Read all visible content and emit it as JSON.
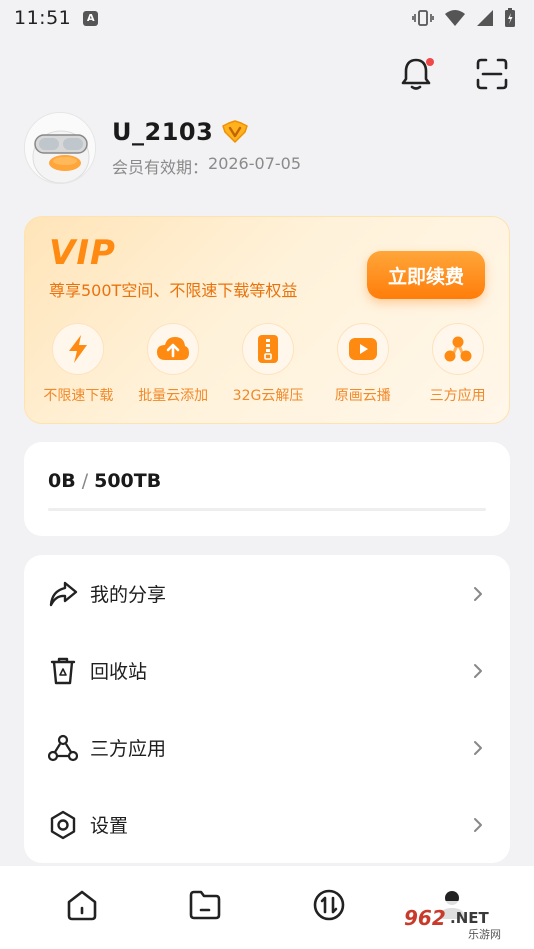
{
  "status_bar": {
    "time": "11:51",
    "badge_letter": "A",
    "icons": [
      "a-icon",
      "vibrate-icon",
      "wifi-icon",
      "signal-icon",
      "battery-icon"
    ]
  },
  "top_actions": {
    "icons": [
      "bell-icon",
      "scan-icon"
    ],
    "has_notification": true
  },
  "profile": {
    "username": "U_2103",
    "member_label": "会员有效期：",
    "member_expiry": "2026-07-05"
  },
  "vip": {
    "title": "VIP",
    "description": "尊享500T空间、不限速下载等权益",
    "renew_label": "立即续费",
    "features": [
      {
        "label": "不限速下载",
        "icon": "lightning-icon"
      },
      {
        "label": "批量云添加",
        "icon": "cloud-upload-icon"
      },
      {
        "label": "32G云解压",
        "icon": "zip-icon"
      },
      {
        "label": "原画云播",
        "icon": "play-icon"
      },
      {
        "label": "三方应用",
        "icon": "apps-icon"
      }
    ]
  },
  "storage": {
    "used": "0B",
    "separator": "/",
    "total": "500TB",
    "used_fraction": 0
  },
  "menu": {
    "items": [
      {
        "label": "我的分享",
        "icon": "share-icon"
      },
      {
        "label": "回收站",
        "icon": "recycle-bin-icon"
      },
      {
        "label": "三方应用",
        "icon": "third-party-apps-icon"
      },
      {
        "label": "设置",
        "icon": "settings-icon"
      }
    ]
  },
  "bottom_nav": {
    "items": [
      "home-icon",
      "folder-icon",
      "transfer-icon",
      "profile-icon"
    ]
  },
  "watermark": {
    "text": "962.NET",
    "subtext": "乐游网"
  },
  "colors": {
    "accent": "#ff8a12",
    "background": "#f2f2f4",
    "notification_dot": "#f04848"
  }
}
